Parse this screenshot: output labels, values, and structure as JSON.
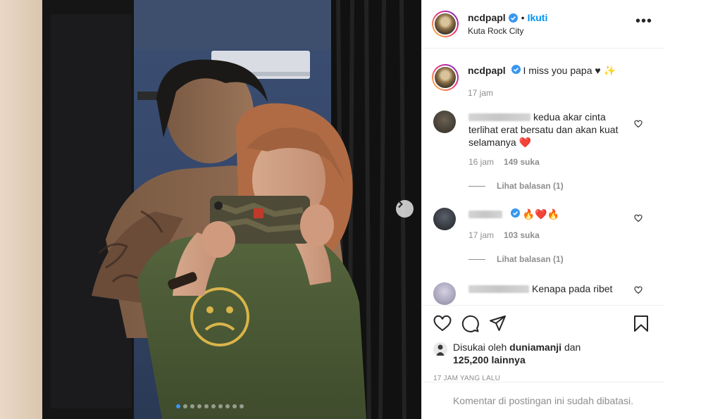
{
  "post": {
    "username": "ncdpapl",
    "follow_label": "Ikuti",
    "separator": "•",
    "location": "Kuta Rock City",
    "more_label": "•••",
    "caption": "I miss you papa ♥ ✨",
    "caption_time": "17 jam"
  },
  "comments": [
    {
      "text": "kedua akar cinta terlihat erat bersatu dan akan kuat selamanya ❤️",
      "time": "16 jam",
      "likes": "149 suka",
      "replies": "Lihat balasan (1)",
      "avatar_color": "#4a4438"
    },
    {
      "text": "🔥❤️🔥",
      "time": "17 jam",
      "likes": "103 suka",
      "replies": "Lihat balasan (1)",
      "avatar_color": "#2c2f36"
    },
    {
      "text": "Kenapa pada ribet",
      "avatar_color": "#b9b6c8"
    }
  ],
  "actions": {
    "liked_by_prefix": "Disukai oleh",
    "liked_by_user": "duniamanji",
    "liked_by_and": "dan",
    "liked_by_count": "125,200 lainnya",
    "post_time": "17 JAM YANG LALU",
    "comments_disabled": "Komentar di postingan ini sudah dibatasi."
  },
  "carousel": {
    "dot_count": 10,
    "active_index": 0
  },
  "colors": {
    "link": "#0095f6",
    "verified": "#3897f0",
    "muted": "#8e8e8e",
    "border": "#efefef",
    "heart_red": "#ed4956"
  },
  "icons": [
    "verified-badge-icon",
    "more-options-icon",
    "heart-icon",
    "comment-icon",
    "share-icon",
    "bookmark-icon",
    "chevron-right-icon"
  ]
}
